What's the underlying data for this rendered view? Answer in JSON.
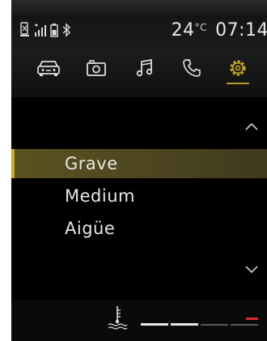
{
  "status": {
    "temperature": "24",
    "temperature_unit": "°C",
    "time": "07:14",
    "icons": [
      "phone-battery-icon",
      "signal-icon",
      "battery-icon",
      "bluetooth-icon"
    ]
  },
  "tabs": [
    {
      "name": "vehicle",
      "icon": "car-icon",
      "active": false
    },
    {
      "name": "media",
      "icon": "camera-icon",
      "active": false
    },
    {
      "name": "music",
      "icon": "music-note-icon",
      "active": false
    },
    {
      "name": "phone",
      "icon": "phone-icon",
      "active": false
    },
    {
      "name": "settings",
      "icon": "gear-icon",
      "active": true
    }
  ],
  "menu": {
    "items": [
      {
        "label": "Grave",
        "selected": true
      },
      {
        "label": "Medium",
        "selected": false
      },
      {
        "label": "Aigüe",
        "selected": false
      }
    ],
    "scroll_up_icon": "chevron-up-icon",
    "scroll_down_icon": "chevron-down-icon"
  },
  "bottom": {
    "coolant_icon": "coolant-temperature-icon",
    "gauge_level_segments_lit": 2,
    "gauge_total_segments": 4
  },
  "colors": {
    "accent": "#c8a92a",
    "selected_bg": "#5b5120",
    "warning": "#e0292f",
    "text": "#e8e8e8"
  }
}
